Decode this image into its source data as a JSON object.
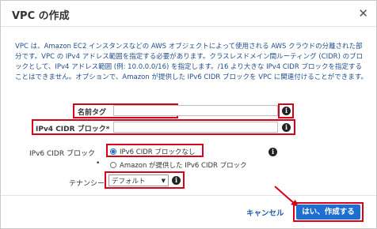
{
  "dialog": {
    "title": "VPC の作成",
    "close_glyph": "✕",
    "description": "VPC は、Amazon EC2 インスタンスなどの AWS オブジェクトによって使用される AWS クラウドの分離された部分です。VPC の IPv4 アドレス範囲を指定する必要があります。クラスレスドメイン間ルーティング (CIDR) のブロックとして、IPv4 アドレス範囲 (例: 10.0.0.0/16) を指定します。/16 より大きな IPv4 CIDR ブロックを指定することはできません。オプションで、Amazon が提供した IPv6 CIDR ブロックを VPC に関連付けることができます。"
  },
  "form": {
    "name_tag": {
      "label": "名前タグ",
      "value": ""
    },
    "ipv4_cidr": {
      "label": "IPv4 CIDR ブロック*",
      "value": ""
    },
    "ipv6_cidr": {
      "label": "IPv6 CIDR ブロック",
      "options": [
        "IPv6 CIDR ブロックなし",
        "Amazon が提供した IPv6 CIDR ブロック"
      ],
      "selected": 0
    },
    "tenancy": {
      "label": "テナンシー",
      "value": "デフォルト"
    },
    "info_glyph": "i"
  },
  "footer": {
    "cancel_label": "キャンセル",
    "create_label": "はい、作成する"
  },
  "colors": {
    "highlight": "#d9001b",
    "primary": "#1f6fd1"
  }
}
